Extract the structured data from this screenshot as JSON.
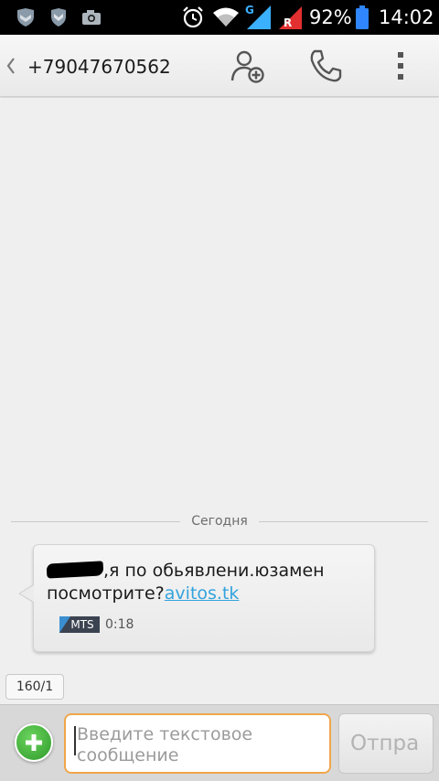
{
  "status_bar": {
    "battery_percent": "92%",
    "time": "14:02",
    "network_type": "G",
    "icons": [
      "shield-icon",
      "shield-check-icon",
      "camera-icon",
      "alarm-icon",
      "wifi-icon",
      "signal-icon",
      "signal-roaming-icon",
      "battery-icon"
    ]
  },
  "action_bar": {
    "contact_number": "+79047670562",
    "icons": [
      "back-chevron-icon",
      "add-contact-icon",
      "phone-icon",
      "overflow-menu-icon"
    ]
  },
  "conversation": {
    "date_divider": "Сегодня",
    "messages": [
      {
        "text_before_link": ",я по обьявлени.юзамен посмотрите?",
        "link_text": "avitos.tk",
        "sim_label": "MTS",
        "time": "0:18"
      }
    ]
  },
  "char_counter": "160/1",
  "compose": {
    "placeholder": "Введите текстовое сообщение",
    "value": "",
    "send_label": "Отпра"
  },
  "colors": {
    "accent_orange": "#f0a64a",
    "link_blue": "#33a3dc",
    "attach_green": "#2e9a2a"
  }
}
